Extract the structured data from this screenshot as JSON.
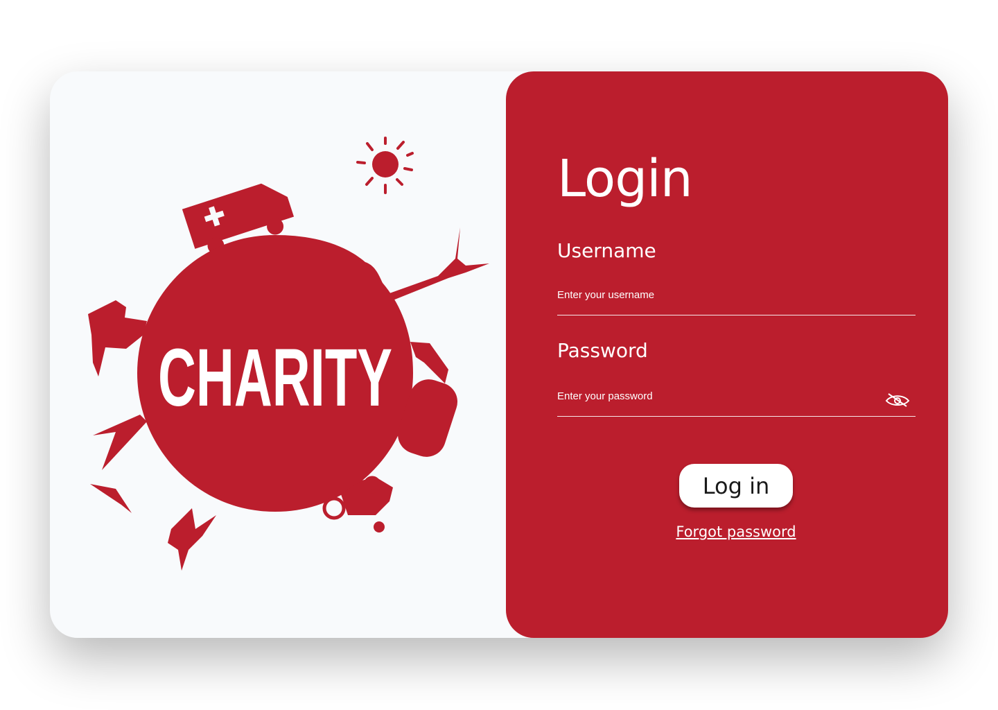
{
  "brand": {
    "logo_text": "CHARITY",
    "accent_color": "#bb1e2d"
  },
  "login": {
    "title": "Login",
    "username_label": "Username",
    "username_placeholder": "Enter your username",
    "username_value": "",
    "password_label": "Password",
    "password_placeholder": "Enter your password",
    "password_value": "",
    "toggle_icon": "eye-slash-icon",
    "submit_label": "Log in",
    "forgot_label": "Forgot password"
  }
}
